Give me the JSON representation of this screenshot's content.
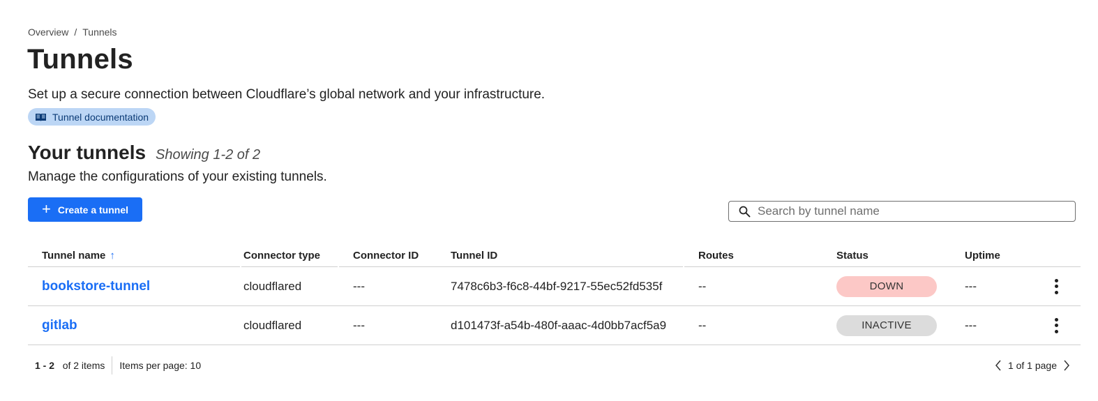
{
  "breadcrumb": {
    "items": [
      "Overview",
      "Tunnels"
    ],
    "separator": "/"
  },
  "page": {
    "title": "Tunnels",
    "description": "Set up a secure connection between Cloudflare’s global network and your infrastructure.",
    "doc_link": {
      "label": "Tunnel documentation",
      "icon": "book-icon"
    }
  },
  "section": {
    "title": "Your tunnels",
    "count_text": "Showing 1-2 of 2",
    "description": "Manage the configurations of your existing tunnels."
  },
  "actions": {
    "create_label": "Create a tunnel",
    "create_icon": "plus-icon"
  },
  "search": {
    "placeholder": "Search by tunnel name",
    "value": "",
    "icon": "search-icon"
  },
  "table": {
    "columns": {
      "name": "Tunnel name",
      "connector_type": "Connector type",
      "connector_id": "Connector ID",
      "tunnel_id": "Tunnel ID",
      "routes": "Routes",
      "status": "Status",
      "uptime": "Uptime"
    },
    "sort_indicator": "↑",
    "rows": [
      {
        "name": "bookstore-tunnel",
        "connector_type": "cloudflared",
        "connector_id": "---",
        "tunnel_id": "7478c6b3-f6c8-44bf-9217-55ec52fd535f",
        "routes": "--",
        "status": "DOWN",
        "uptime": "---"
      },
      {
        "name": "gitlab",
        "connector_type": "cloudflared",
        "connector_id": "---",
        "tunnel_id": "d101473f-a54b-480f-aaac-4d0bb7acf5a9",
        "routes": "--",
        "status": "INACTIVE",
        "uptime": "---"
      }
    ]
  },
  "pagination": {
    "range": "1 - 2",
    "of_items": "of 2 items",
    "items_per_page": "Items per page: 10",
    "page_text": "1 of 1 page"
  },
  "colors": {
    "accent": "#1a6ef5",
    "status_down": "#fcc8c6",
    "status_inactive": "#dcdcdc",
    "doc_pill": "#bcd6f5"
  }
}
